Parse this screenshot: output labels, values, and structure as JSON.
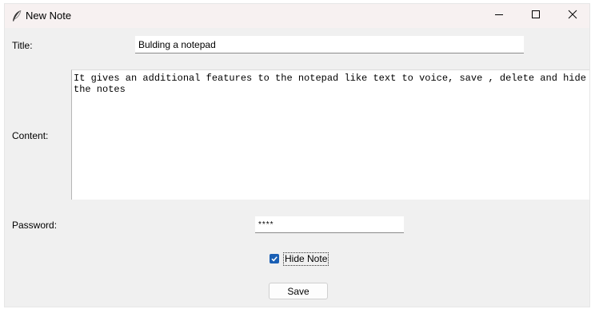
{
  "window": {
    "title": "New Note",
    "icon": "feather-icon",
    "controls": [
      "minimize-icon",
      "maximize-icon",
      "close-icon"
    ]
  },
  "form": {
    "title_label": "Title:",
    "title_value": "Bulding a notepad",
    "content_label": "Content:",
    "content_value": "It gives an additional features to the notepad like text to voice, save , delete and hide the notes",
    "password_label": "Password:",
    "password_value": "****",
    "hide_note_label": "Hide Note",
    "hide_note_checked": true,
    "save_label": "Save"
  },
  "colors": {
    "accent": "#1a5fb4",
    "window_bg": "#f0f0f0",
    "titlebar_bg": "#f7f1f1"
  }
}
